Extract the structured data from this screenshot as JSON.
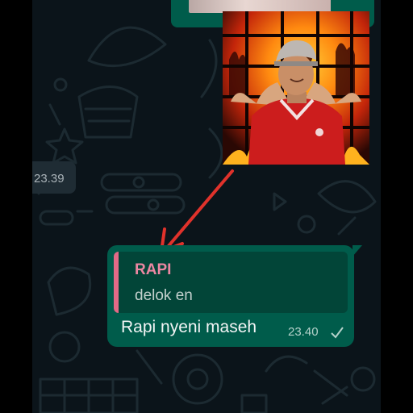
{
  "chat": {
    "left_message": {
      "time": "23.39"
    },
    "reply_message": {
      "quote_author": "RAPI",
      "quote_text": "delok en",
      "text": "Rapi nyeni maseh",
      "time": "23.40"
    }
  },
  "colors": {
    "chat_bg": "#0b141a",
    "outgoing_bubble": "#005c4b",
    "incoming_bubble": "#1f2c34",
    "quote_accent": "#e26a87",
    "arrow": "#e0322b"
  },
  "icons": {
    "sent": "single-check-icon"
  }
}
